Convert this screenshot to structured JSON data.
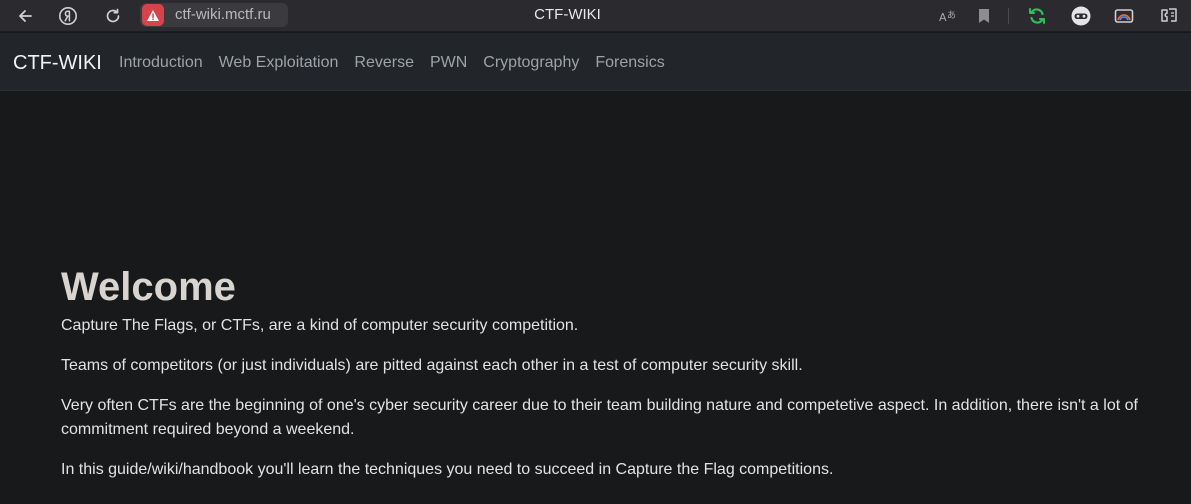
{
  "browser": {
    "url": "ctf-wiki.mctf.ru",
    "tab_title": "CTF-WIKI"
  },
  "navbar": {
    "brand": "CTF-WIKI",
    "links": [
      {
        "label": "Introduction"
      },
      {
        "label": "Web Exploitation"
      },
      {
        "label": "Reverse"
      },
      {
        "label": "PWN"
      },
      {
        "label": "Cryptography"
      },
      {
        "label": "Forensics"
      }
    ]
  },
  "main": {
    "title": "Welcome",
    "paragraphs": [
      "Capture The Flags, or CTFs, are a kind of computer security competition.",
      "Teams of competitors (or just individuals) are pitted against each other in a test of computer security skill.",
      "Very often CTFs are the beginning of one's cyber security career due to their team building nature and competetive aspect. In addition, there isn't a lot of commitment required beyond a weekend.",
      "In this guide/wiki/handbook you'll learn the techniques you need to succeed in Capture the Flag competitions."
    ]
  },
  "colors": {
    "page_background": "#18191b",
    "navbar_background": "#222529",
    "browser_bar": "#2b2b2f",
    "warning_red": "#d6434a",
    "sync_green": "#2fbf5a"
  },
  "icons": {
    "back": "back-arrow-icon",
    "yandex": "yandex-logo-icon",
    "reload": "reload-icon",
    "warning": "warning-icon",
    "translate": "translate-icon",
    "bookmark": "bookmark-icon",
    "sync": "sync-icon",
    "vpn": "vpn-mask-icon",
    "media": "media-icon",
    "extensions": "extensions-icon"
  }
}
